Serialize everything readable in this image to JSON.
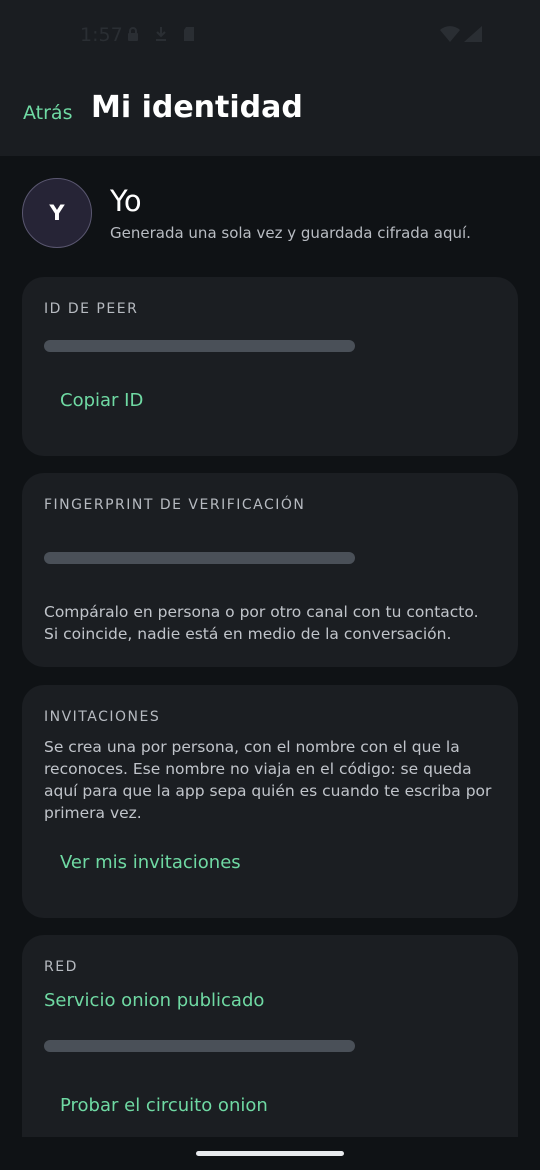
{
  "status": {
    "time": "1:57"
  },
  "header": {
    "back_label": "Atrás",
    "title": "Mi identidad"
  },
  "profile": {
    "avatar_initial": "Y",
    "name": "Yo",
    "subtitle": "Generada una sola vez y guardada cifrada aquí."
  },
  "peer_card": {
    "label": "ID DE PEER",
    "copy_label": "Copiar ID"
  },
  "fingerprint_card": {
    "label": "FINGERPRINT DE VERIFICACIÓN",
    "line1": "Compáralo en persona o por otro canal con tu contacto.",
    "line2": "Si coincide, nadie está en medio de la conversación."
  },
  "invites_card": {
    "label": "INVITACIONES",
    "line1": "Se crea una por persona, con el nombre con el que la",
    "line2": "reconoces. Ese nombre no viaja en el código: se queda",
    "line3": "aquí para que la app sepa quién es cuando te escriba por",
    "line4": "primera vez.",
    "action_label": "Ver mis invitaciones"
  },
  "network_card": {
    "label": "RED",
    "status": "Servicio onion publicado",
    "action_label": "Probar el circuito onion"
  },
  "colors": {
    "accent": "#6fd9a3",
    "card": "#1b1e22",
    "background": "#0f1215"
  }
}
